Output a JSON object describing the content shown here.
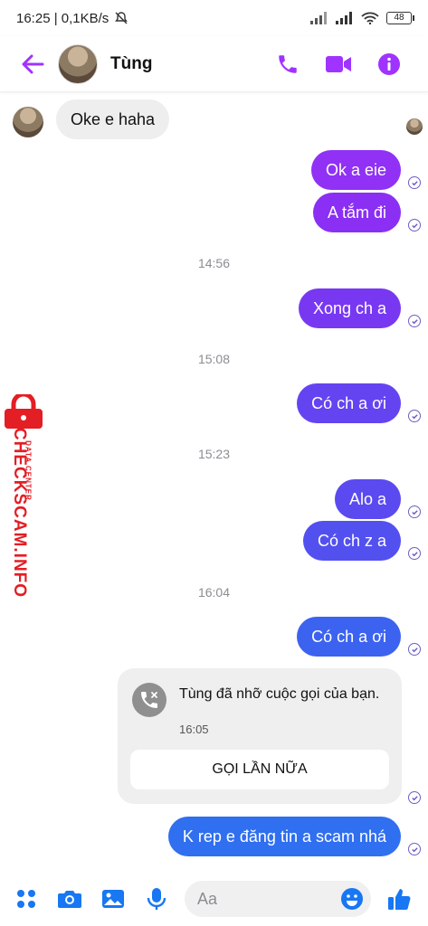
{
  "status_bar": {
    "time_speed": "16:25 | 0,1KB/s",
    "battery": "48"
  },
  "header": {
    "contact_name": "Tùng"
  },
  "messages": {
    "in_1": "Oke e haha",
    "out_1": "Ok a eie",
    "out_2": "A tắm đi",
    "ts_1": "14:56",
    "out_3": "Xong ch a",
    "ts_2": "15:08",
    "out_4": "Có ch a ơi",
    "ts_3": "15:23",
    "out_5": "Alo a",
    "out_6": "Có ch z a",
    "ts_4": "16:04",
    "out_7": "Có ch a ơi",
    "out_8": "K rep e đăng tin a scam nhá"
  },
  "missed_call": {
    "text": "Tùng đã nhỡ cuộc gọi của bạn.",
    "time": "16:05",
    "call_again_label": "GỌI LẦN NỮA"
  },
  "composer": {
    "placeholder": "Aa"
  },
  "watermark": {
    "main": "CHECKSCAM.INFO",
    "sub": "DATA CENTER"
  },
  "colors": {
    "purple_accent": "#a033ff",
    "bubble_violet": "#8e2ef5",
    "bubble_indigo": "#5b4ff0",
    "bubble_blue": "#2f6ff0",
    "composer_blue": "#1877f2"
  },
  "icons": [
    "back-arrow-icon",
    "phone-icon",
    "video-icon",
    "info-icon",
    "apps-icon",
    "camera-icon",
    "image-icon",
    "mic-icon",
    "emoji-icon",
    "like-icon",
    "missed-call-icon",
    "seen-check-icon"
  ]
}
